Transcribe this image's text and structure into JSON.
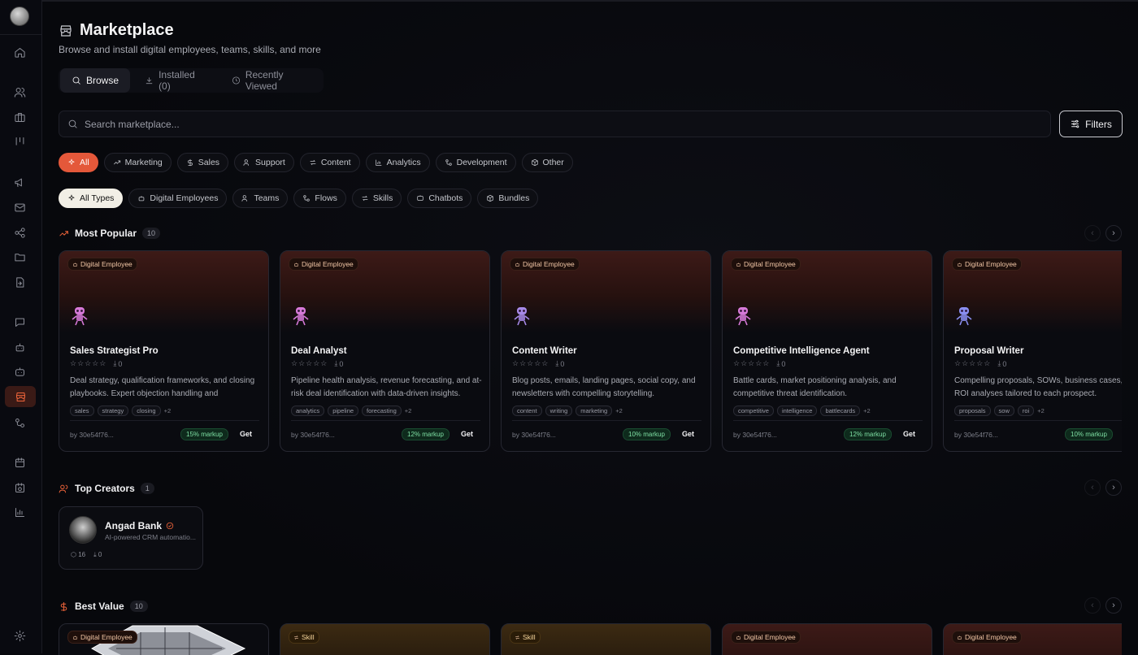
{
  "sidebar": {
    "items": [
      "home-icon",
      "users-icon",
      "briefcase-icon",
      "kanban-icon",
      "megaphone-icon",
      "mail-icon",
      "share-icon",
      "folder-icon",
      "file-import-icon",
      "chat-icon",
      "bot-icon",
      "chatbot-icon",
      "store-icon",
      "workflow-icon",
      "calendar-icon",
      "calendar-clock-icon",
      "bar-chart-icon",
      "settings-icon"
    ],
    "active": "store-icon"
  },
  "header": {
    "title": "Marketplace",
    "subtitle": "Browse and install digital employees, teams, skills, and more"
  },
  "tabs": [
    {
      "label": "Browse",
      "icon": "search-icon",
      "active": true
    },
    {
      "label": "Installed (0)",
      "icon": "download-icon",
      "active": false
    },
    {
      "label": "Recently Viewed",
      "icon": "clock-icon",
      "active": false
    }
  ],
  "search": {
    "placeholder": "Search marketplace..."
  },
  "filters_label": "Filters",
  "categories": [
    "All",
    "Marketing",
    "Sales",
    "Support",
    "Content",
    "Analytics",
    "Development",
    "Other"
  ],
  "types": [
    "All Types",
    "Digital Employees",
    "Teams",
    "Flows",
    "Skills",
    "Chatbots",
    "Bundles"
  ],
  "sections": {
    "popular": {
      "title": "Most Popular",
      "count": "10"
    },
    "creators": {
      "title": "Top Creators",
      "count": "1"
    },
    "value": {
      "title": "Best Value",
      "count": "10"
    }
  },
  "cards": [
    {
      "badge": "Digital Employee",
      "name": "Sales Strategist Pro",
      "stars": "☆☆☆☆☆",
      "downloads": "0",
      "desc": "Deal strategy, qualification frameworks, and closing playbooks. Expert objection handling and negotiatio...",
      "tags": [
        "sales",
        "strategy",
        "closing"
      ],
      "more": "+2",
      "by": "by 30e54f76...",
      "markup": "15% markup",
      "get": "Get",
      "robot_color": "#d77ad9"
    },
    {
      "badge": "Digital Employee",
      "name": "Deal Analyst",
      "stars": "☆☆☆☆☆",
      "downloads": "0",
      "desc": "Pipeline health analysis, revenue forecasting, and at-risk deal identification with data-driven insights.",
      "tags": [
        "analytics",
        "pipeline",
        "forecasting"
      ],
      "more": "+2",
      "by": "by 30e54f76...",
      "markup": "12% markup",
      "get": "Get",
      "robot_color": "#d77ad9"
    },
    {
      "badge": "Digital Employee",
      "name": "Content Writer",
      "stars": "☆☆☆☆☆",
      "downloads": "0",
      "desc": "Blog posts, emails, landing pages, social copy, and newsletters with compelling storytelling.",
      "tags": [
        "content",
        "writing",
        "marketing"
      ],
      "more": "+2",
      "by": "by 30e54f76...",
      "markup": "10% markup",
      "get": "Get",
      "robot_color": "#a78ae8"
    },
    {
      "badge": "Digital Employee",
      "name": "Competitive Intelligence Agent",
      "stars": "☆☆☆☆☆",
      "downloads": "0",
      "desc": "Battle cards, market positioning analysis, and competitive threat identification.",
      "tags": [
        "competitive",
        "intelligence",
        "battlecards"
      ],
      "more": "+2",
      "by": "by 30e54f76...",
      "markup": "12% markup",
      "get": "Get",
      "robot_color": "#d77ad9"
    },
    {
      "badge": "Digital Employee",
      "name": "Proposal Writer",
      "stars": "☆☆☆☆☆",
      "downloads": "0",
      "desc": "Compelling proposals, SOWs, business cases, and ROI analyses tailored to each prospect.",
      "tags": [
        "proposals",
        "sow",
        "roi"
      ],
      "more": "+2",
      "by": "by 30e54f76...",
      "markup": "10% markup",
      "get": "",
      "robot_color": "#8a8ef0"
    }
  ],
  "creator": {
    "name": "Angad Bank",
    "desc": "AI-powered CRM automatio...",
    "items": "16",
    "downloads": "0"
  },
  "bottom_cards": [
    {
      "badge": "Digital Employee",
      "kind": "img"
    },
    {
      "badge": "Skill",
      "kind": "skill"
    },
    {
      "badge": "Skill",
      "kind": "skill"
    },
    {
      "badge": "Digital Employee",
      "kind": "emp"
    },
    {
      "badge": "Digital Employee",
      "kind": "emp"
    }
  ]
}
